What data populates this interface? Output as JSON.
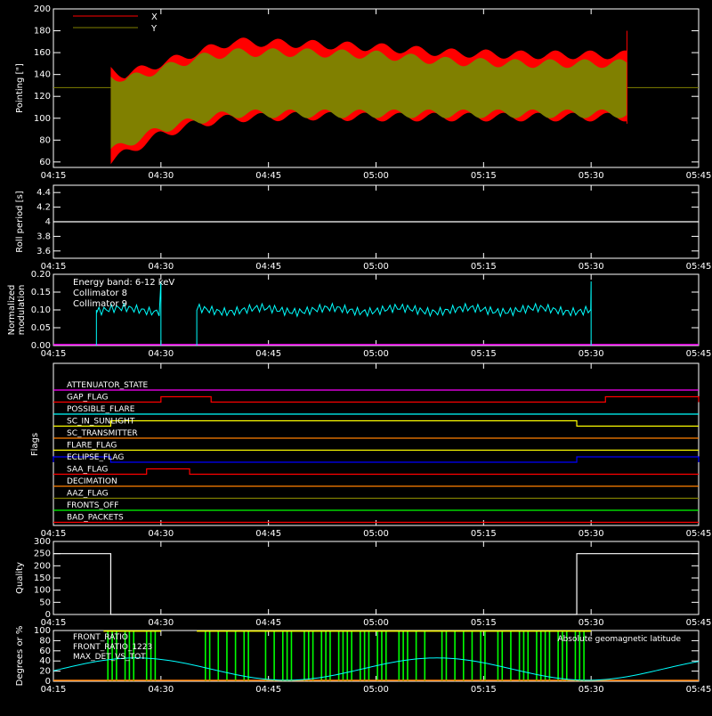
{
  "time_ticks": [
    "04:15",
    "04:30",
    "04:45",
    "05:00",
    "05:15",
    "05:30",
    "05:45"
  ],
  "x_range_minutes": [
    255,
    345
  ],
  "colors": {
    "x": "#ff0000",
    "y": "#808000",
    "white": "#ffffff",
    "cyan": "#00ffff",
    "magenta": "#ff00ff",
    "green": "#00ff00",
    "yellow": "#ffff00",
    "orange": "#ff8000"
  },
  "chart_data": [
    {
      "id": "pointing",
      "type": "line",
      "ylabel": "Pointing [\"]",
      "ylim": [
        55,
        200
      ],
      "yticks": [
        60,
        80,
        100,
        120,
        140,
        160,
        180,
        200
      ],
      "series": [
        {
          "name": "X",
          "color": "#ff0000",
          "x": [
            263,
            265,
            270,
            275,
            280,
            290,
            300,
            310,
            320,
            330,
            335
          ],
          "ymin": [
            60,
            68,
            85,
            95,
            100,
            102,
            101,
            101,
            101,
            101,
            101
          ],
          "ymax": [
            145,
            140,
            150,
            160,
            170,
            168,
            165,
            160,
            158,
            158,
            158
          ]
        },
        {
          "name": "Y",
          "color": "#808000",
          "x": [
            263,
            265,
            270,
            275,
            280,
            290,
            300,
            310,
            320,
            330,
            335
          ],
          "ymin": [
            70,
            76,
            90,
            98,
            104,
            104,
            104,
            104,
            104,
            104,
            104
          ],
          "ymax": [
            140,
            135,
            145,
            155,
            160,
            160,
            158,
            152,
            150,
            150,
            150
          ]
        }
      ],
      "baseline": 128
    },
    {
      "id": "roll",
      "type": "line",
      "ylabel": "Roll period [s]",
      "ylim": [
        3.5,
        4.5
      ],
      "yticks": [
        3.6,
        3.8,
        4.0,
        4.2,
        4.4
      ],
      "value": 4.0
    },
    {
      "id": "modulation",
      "type": "line",
      "ylabel": "Normalized modulation",
      "ylim": [
        0,
        0.2
      ],
      "yticks": [
        "0.00",
        "0.05",
        "0.10",
        "0.15",
        "0.20"
      ],
      "annotation": "Energy band: 6-12 keV",
      "series": [
        {
          "name": "Collimator 8",
          "color": "#00ffff",
          "segments": [
            [
              261,
              270
            ],
            [
              275,
              330
            ]
          ],
          "level": 0.1
        },
        {
          "name": "Collimator 9",
          "color": "#ff00ff",
          "level": 0.0
        }
      ]
    },
    {
      "id": "flags",
      "type": "line",
      "ylabel": "Flags",
      "flags": [
        {
          "name": "ATTENUATOR_STATE",
          "color": "#ff00ff"
        },
        {
          "name": "GAP_FLAG",
          "color": "#ff0000",
          "high": [
            [
              270,
              277
            ],
            [
              332,
              345
            ]
          ]
        },
        {
          "name": "POSSIBLE_FLARE",
          "color": "#00ffff"
        },
        {
          "name": "SC_IN_SUNLIGHT",
          "color": "#ffff00",
          "high": [
            [
              263,
              328
            ]
          ]
        },
        {
          "name": "SC_TRANSMITTER",
          "color": "#ff8000"
        },
        {
          "name": "FLARE_FLAG",
          "color": "#ffff00"
        },
        {
          "name": "ECLIPSE_FLAG",
          "color": "#0000ff",
          "high": [
            [
              250,
              263
            ],
            [
              328,
              345
            ]
          ]
        },
        {
          "name": "SAA_FLAG",
          "color": "#ff0000",
          "high": [
            [
              268,
              274
            ]
          ]
        },
        {
          "name": "DECIMATION",
          "color": "#ff8000"
        },
        {
          "name": "AAZ_FLAG",
          "color": "#808000"
        },
        {
          "name": "FRONTS_OFF",
          "color": "#00ff00"
        },
        {
          "name": "BAD_PACKETS",
          "color": "#ff0000"
        }
      ]
    },
    {
      "id": "quality",
      "type": "line",
      "ylabel": "Quality",
      "ylim": [
        0,
        300
      ],
      "yticks": [
        0,
        50,
        100,
        150,
        200,
        250,
        300
      ],
      "x": [
        250,
        263,
        263,
        328,
        328,
        345
      ],
      "y": [
        250,
        250,
        0,
        0,
        250,
        250
      ]
    },
    {
      "id": "degrees",
      "type": "line",
      "ylabel": "Degrees or %",
      "ylim": [
        0,
        100
      ],
      "yticks": [
        0,
        20,
        40,
        60,
        80,
        100
      ],
      "series": [
        {
          "name": "FRONT_RATIO",
          "color": "#ffff00"
        },
        {
          "name": "FRONT_RATIO_1223",
          "color": "#00ff00"
        },
        {
          "name": "MAX_DET_VS_TOT",
          "color": "#ff8000"
        }
      ],
      "annotation": "Absolute geomagnetic latitude",
      "latitude": {
        "x": [
          250,
          255,
          260,
          264,
          270,
          276,
          282,
          288,
          294,
          300,
          306,
          312,
          318,
          324,
          330,
          336,
          342,
          345
        ],
        "y": [
          36,
          28,
          15,
          3,
          15,
          35,
          42,
          48,
          40,
          25,
          5,
          25,
          40,
          45,
          47,
          42,
          30,
          25
        ]
      }
    }
  ]
}
